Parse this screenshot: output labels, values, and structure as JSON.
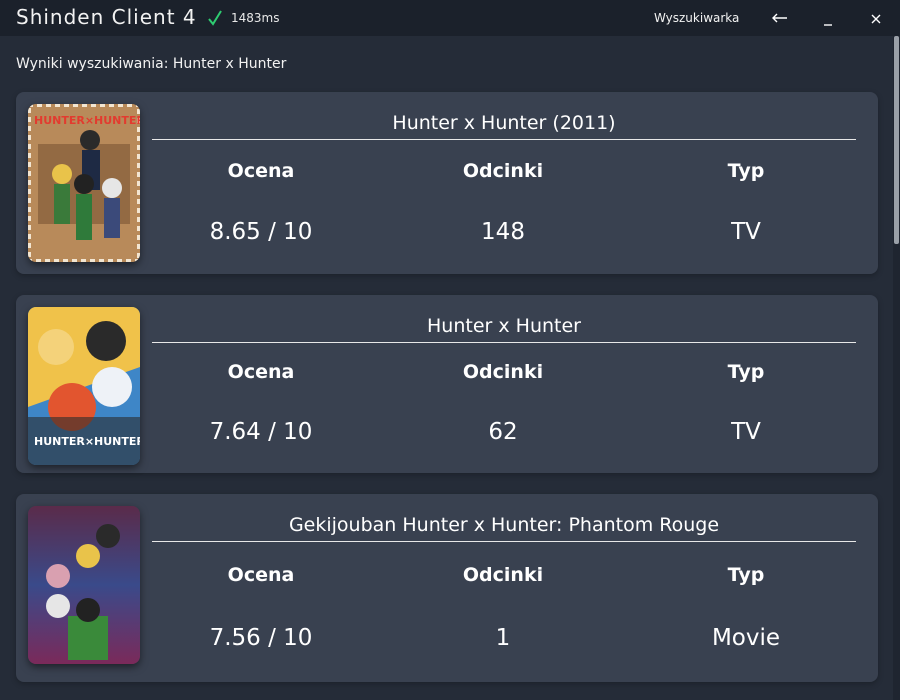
{
  "app": {
    "title": "Shinden Client 4",
    "ping": "1483ms",
    "nav_search": "Wyszukiwarka",
    "accent": "#2ecc71"
  },
  "search": {
    "label": "Wyniki wyszukiwania: Hunter x Hunter"
  },
  "columns": {
    "rating": "Ocena",
    "episodes": "Odcinki",
    "type": "Typ"
  },
  "results": [
    {
      "title": "Hunter x Hunter (2011)",
      "rating": "8.65 / 10",
      "episodes": "148",
      "type": "TV",
      "cover_text": "HUNTER×HUNTER"
    },
    {
      "title": "Hunter x Hunter",
      "rating": "7.64 / 10",
      "episodes": "62",
      "type": "TV",
      "cover_text": "HUNTER×HUNTER"
    },
    {
      "title": "Gekijouban Hunter x Hunter: Phantom Rouge",
      "rating": "7.56 / 10",
      "episodes": "1",
      "type": "Movie"
    }
  ]
}
